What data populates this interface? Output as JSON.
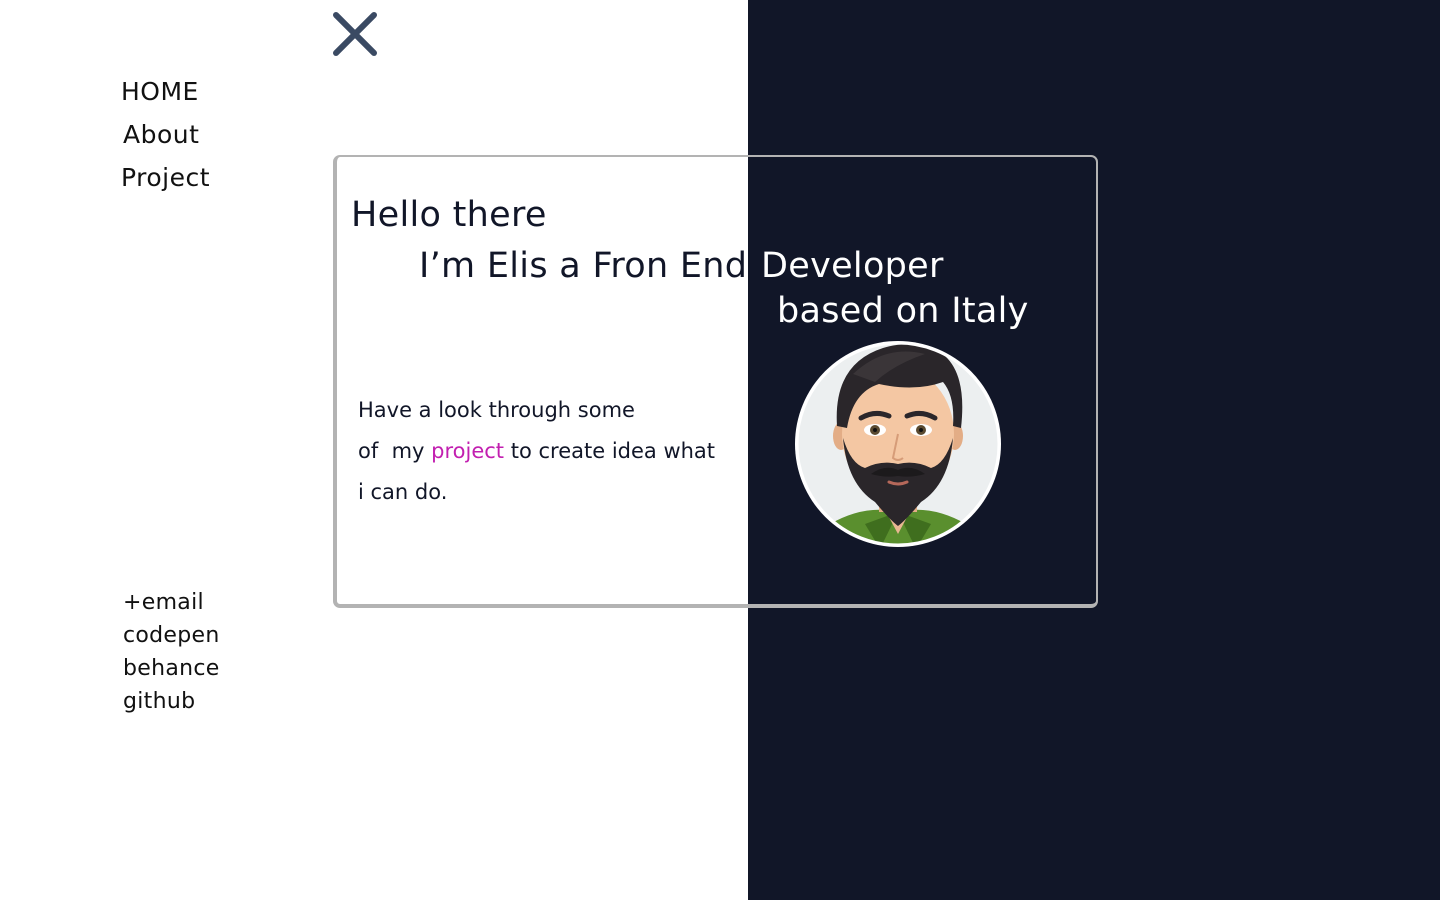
{
  "nav": {
    "items": [
      {
        "label": "HOME"
      },
      {
        "label": "About"
      },
      {
        "label": "Project"
      }
    ]
  },
  "contacts": {
    "items": [
      {
        "label": "+email"
      },
      {
        "label": "codepen"
      },
      {
        "label": "behance"
      },
      {
        "label": "github"
      }
    ]
  },
  "hero": {
    "greeting": "Hello there",
    "intro_left": "I’m Elis a Fron End",
    "intro_right": "Developer",
    "location": "based on Italy"
  },
  "description": {
    "line1": "Have a look through some",
    "line2_prefix": "of  my ",
    "link": "project",
    "line2_suffix": " to create idea what",
    "line3": "i can do."
  },
  "icons": {
    "close": "close-icon",
    "avatar": "avatar"
  },
  "colors": {
    "dark_bg": "#111628",
    "accent": "#c21fb0",
    "close_icon": "#3a4a63",
    "card_border": "#b3b3b3"
  }
}
